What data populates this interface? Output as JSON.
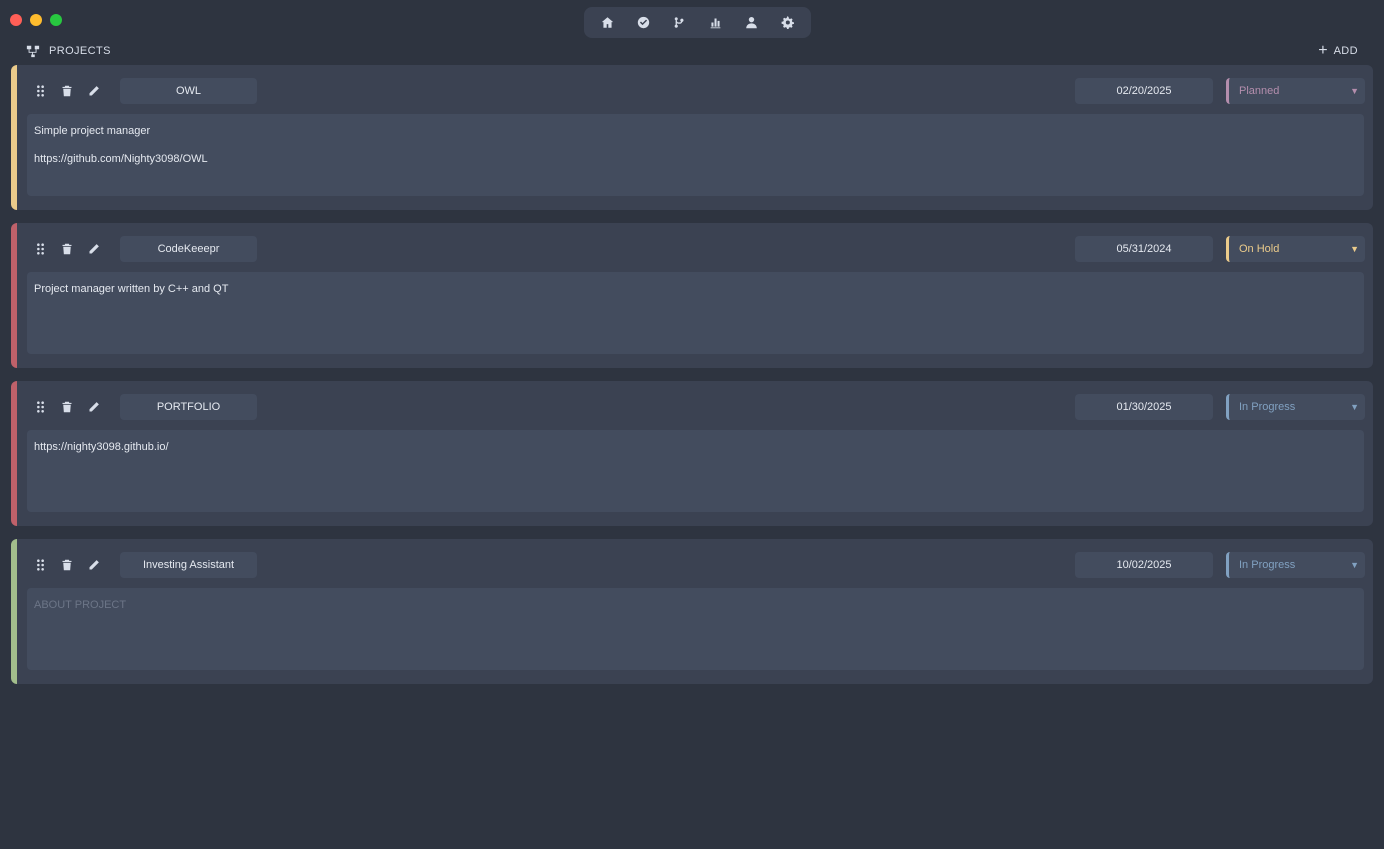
{
  "app": {
    "nav": [
      {
        "icon": "home-icon"
      },
      {
        "icon": "check-circle-icon"
      },
      {
        "icon": "git-branch-icon"
      },
      {
        "icon": "bar-chart-icon"
      },
      {
        "icon": "user-icon"
      },
      {
        "icon": "gear-icon"
      }
    ]
  },
  "header": {
    "title": "PROJECTS",
    "add_label": "ADD",
    "add_symbol": "+"
  },
  "projects": [
    {
      "name": "OWL",
      "date": "02/20/2025",
      "status": "Planned",
      "status_color": "#b48ead",
      "accent_color": "#ebcb8b",
      "description": "Simple project manager\n\nhttps://github.com/Nighty3098/OWL",
      "placeholder": ""
    },
    {
      "name": "CodeKeeepr",
      "date": "05/31/2024",
      "status": "On Hold",
      "status_color": "#ebcb8b",
      "accent_color": "#bf616a",
      "description": "Project manager written by C++ and QT",
      "placeholder": ""
    },
    {
      "name": "PORTFOLIO",
      "date": "01/30/2025",
      "status": "In Progress",
      "status_color": "#81a1c1",
      "accent_color": "#bf616a",
      "description": "https://nighty3098.github.io/",
      "placeholder": ""
    },
    {
      "name": "Investing Assistant",
      "date": "10/02/2025",
      "status": "In Progress",
      "status_color": "#81a1c1",
      "accent_color": "#a3be8c",
      "description": "",
      "placeholder": "ABOUT PROJECT"
    }
  ]
}
